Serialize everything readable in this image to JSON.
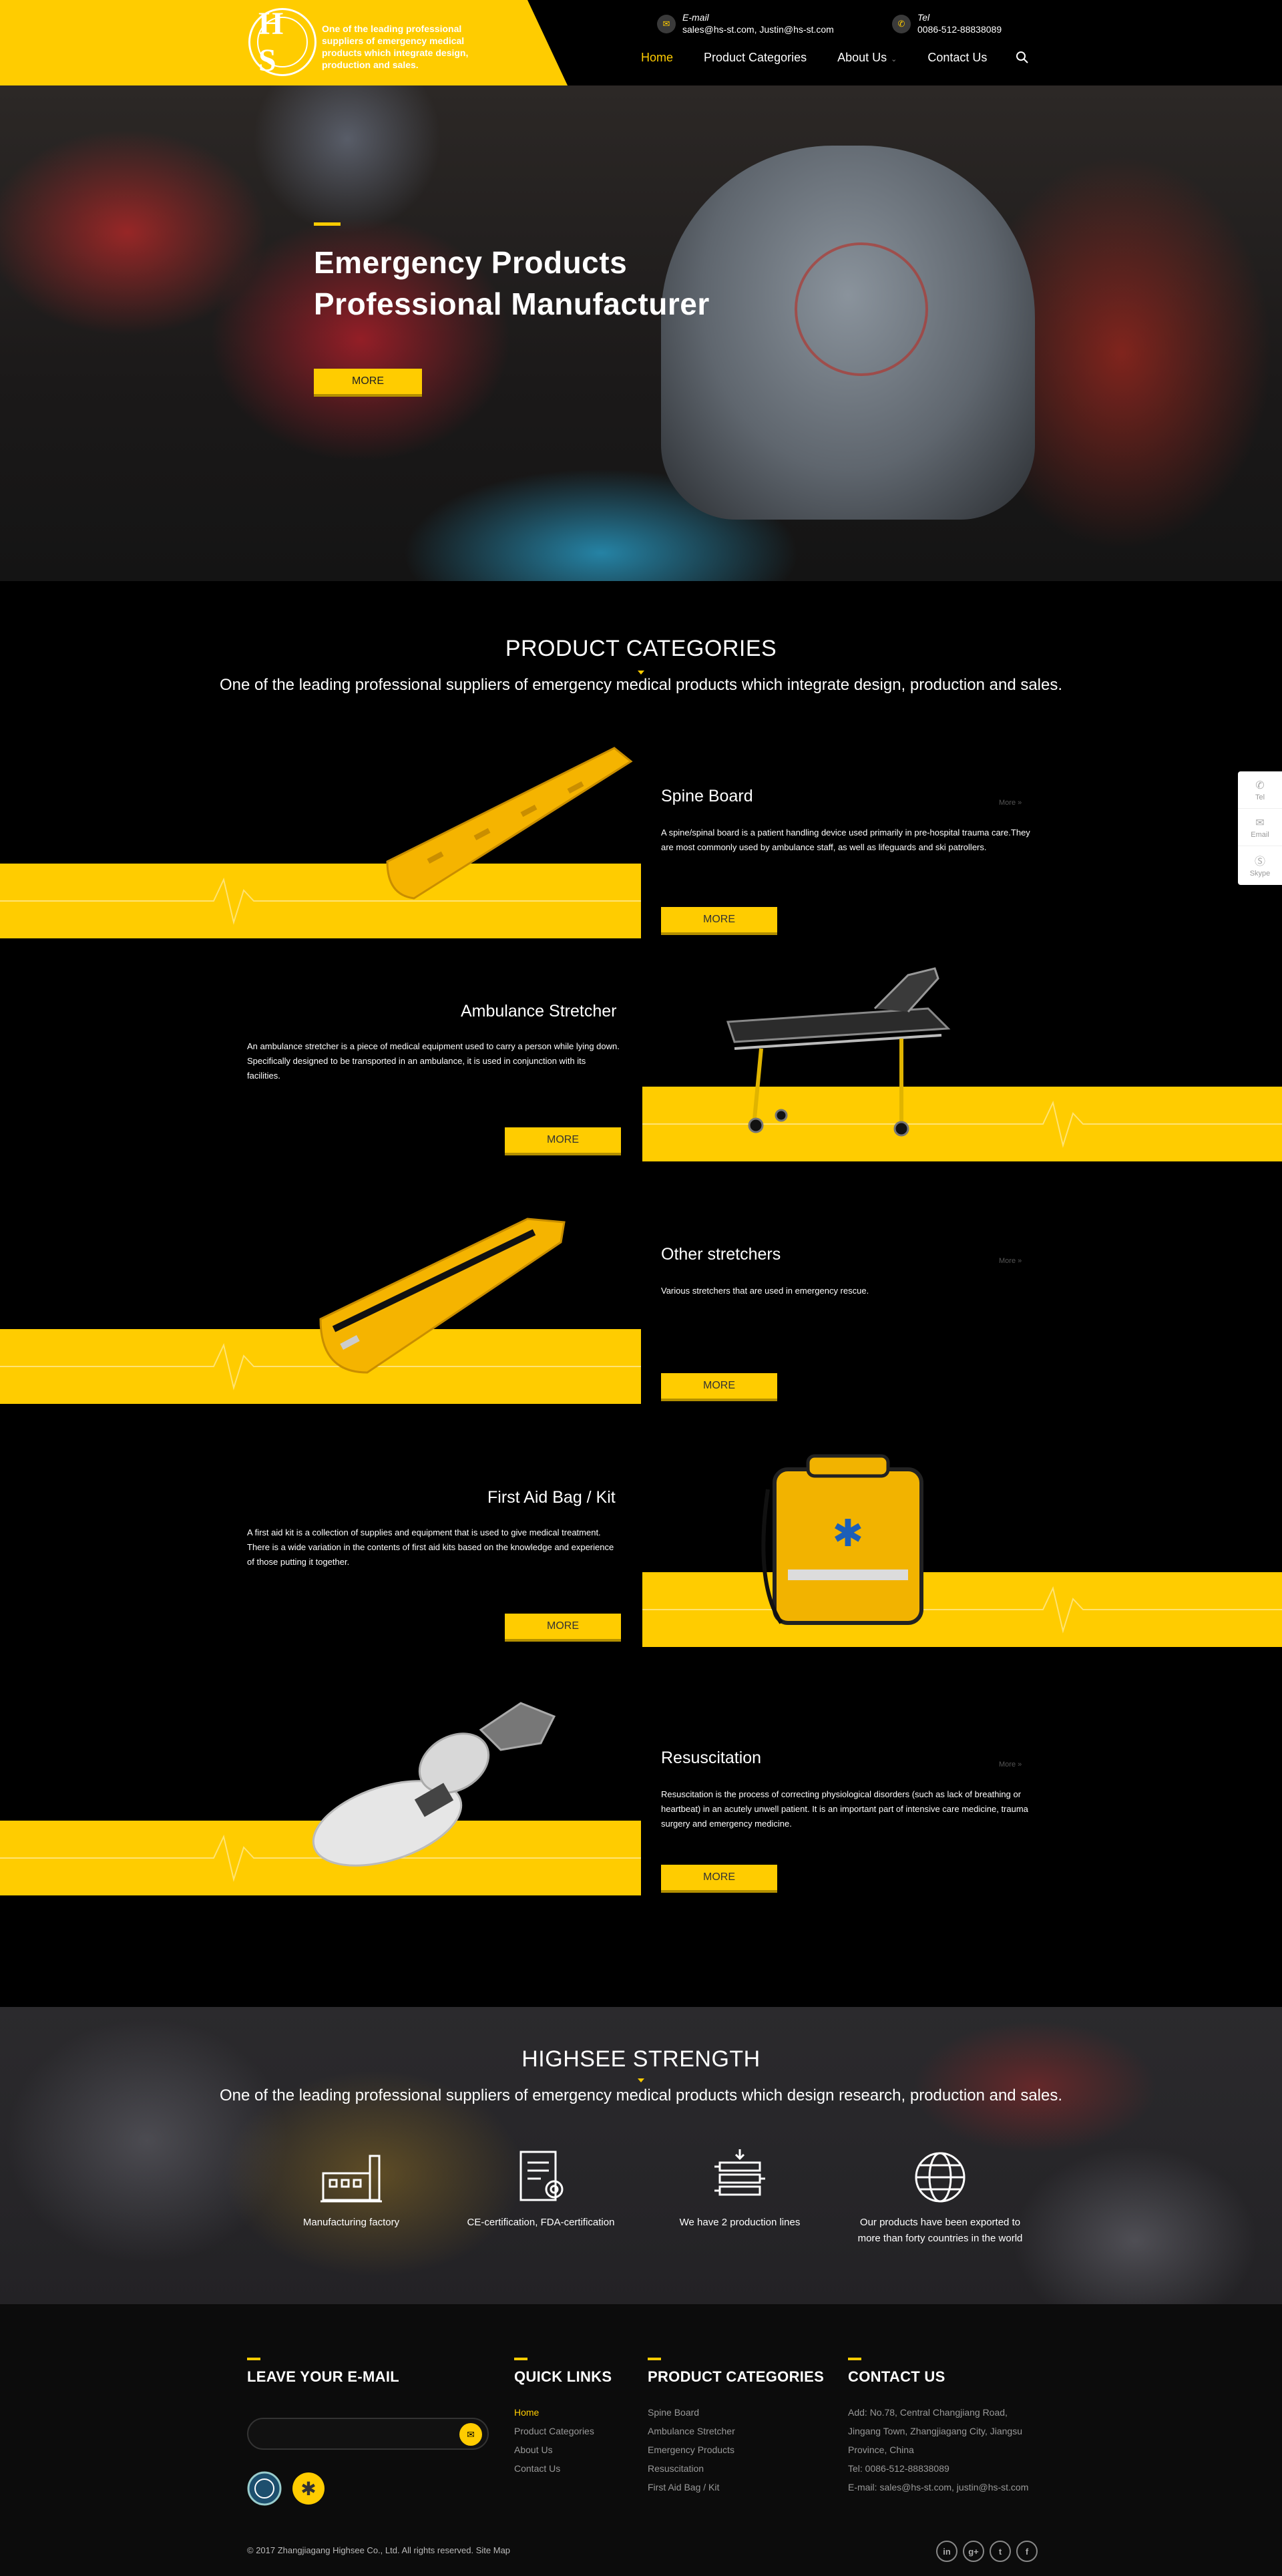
{
  "colors": {
    "accent": "#ffcc00",
    "background": "#000000",
    "footer_bg": "#0c0c0c"
  },
  "header": {
    "logo_text": "One of the leading professional suppliers of emergency medical products which integrate design, production and sales.",
    "logo_letters": "H S",
    "email": {
      "label": "E-mail",
      "value": "sales@hs-st.com, Justin@hs-st.com",
      "icon": "mail-icon"
    },
    "tel": {
      "label": "Tel",
      "value": "0086-512-88838089",
      "icon": "phone-icon"
    },
    "nav": [
      {
        "label": "Home",
        "active": true
      },
      {
        "label": "Product Categories",
        "active": false
      },
      {
        "label": "About Us",
        "active": false
      },
      {
        "label": "Contact Us",
        "active": false
      }
    ],
    "search_icon": "search-icon"
  },
  "hero": {
    "title_line1": "Emergency Products",
    "title_line2": "Professional Manufacturer",
    "button": "MORE"
  },
  "categories": {
    "title": "PRODUCT CATEGORIES",
    "subtitle": "One of the leading professional suppliers of emergency medical products which integrate design, production and sales.",
    "products": [
      {
        "title": "Spine Board",
        "more_link": "More »",
        "desc": "A spine/spinal board is a patient handling device used primarily in pre-hospital trauma care.They are most commonly used by ambulance staff, as well as lifeguards and ski patrollers.",
        "button": "MORE"
      },
      {
        "title": "Ambulance Stretcher",
        "more_link": "",
        "desc": "An ambulance stretcher is a piece of medical equipment used to carry a person while lying down. Specifically designed to be transported in an ambulance, it is used in conjunction with its facilities.",
        "button": "MORE"
      },
      {
        "title": "Other stretchers",
        "more_link": "More »",
        "desc": "Various stretchers that are used in emergency rescue.",
        "button": "MORE"
      },
      {
        "title": "First Aid Bag / Kit",
        "more_link": "",
        "desc": "A first aid kit is a collection of supplies and equipment that is used to give medical treatment. There is a wide variation in the contents of first aid kits based on the knowledge and experience of those putting it together.",
        "button": "MORE"
      },
      {
        "title": "Resuscitation",
        "more_link": "More »",
        "desc": "Resuscitation is the process of correcting physiological disorders (such as lack of breathing or heartbeat) in an acutely unwell patient. It is an important part of intensive care medicine, trauma surgery and emergency medicine.",
        "button": "MORE"
      }
    ]
  },
  "side_widget": [
    {
      "label": "Tel",
      "icon": "phone-icon"
    },
    {
      "label": "Email",
      "icon": "mail-icon"
    },
    {
      "label": "Skype",
      "icon": "skype-icon"
    }
  ],
  "strength": {
    "title": "HIGHSEE STRENGTH",
    "subtitle": "One of the leading professional suppliers of emergency medical products which design research, production and sales.",
    "features": [
      {
        "label": "Manufacturing factory",
        "icon": "factory-icon"
      },
      {
        "label": "CE-certification, FDA-certification",
        "icon": "certificate-icon"
      },
      {
        "label": "We have 2 production lines",
        "icon": "production-line-icon"
      },
      {
        "label": "Our products have been exported to more than forty countries in the world",
        "icon": "globe-icon"
      }
    ]
  },
  "footer": {
    "email_title": "LEAVE YOUR E-MAIL",
    "quick_links_title": "QUICK LINKS",
    "quick_links": [
      "Home",
      "Product Categories",
      "About Us",
      "Contact Us"
    ],
    "product_title": "PRODUCT CATEGORIES",
    "product_links": [
      "Spine Board",
      "Ambulance Stretcher",
      "Emergency Products",
      "Resuscitation",
      "First Aid Bag / Kit"
    ],
    "contact_title": "CONTACT US",
    "contact_lines": [
      "Add: No.78, Central Changjiang Road,",
      "Jingang Town, Zhangjiagang City, Jiangsu",
      "Province, China",
      "Tel: 0086-512-88838089",
      "E-mail: sales@hs-st.com, justin@hs-st.com"
    ],
    "copyright": "© 2017  Zhangjiagang Highsee Co., Ltd. All rights reserved. Site Map",
    "social": [
      {
        "label": "in",
        "icon": "linkedin-icon"
      },
      {
        "label": "g+",
        "icon": "google-plus-icon"
      },
      {
        "label": "t",
        "icon": "twitter-icon"
      },
      {
        "label": "f",
        "icon": "facebook-icon"
      }
    ]
  }
}
